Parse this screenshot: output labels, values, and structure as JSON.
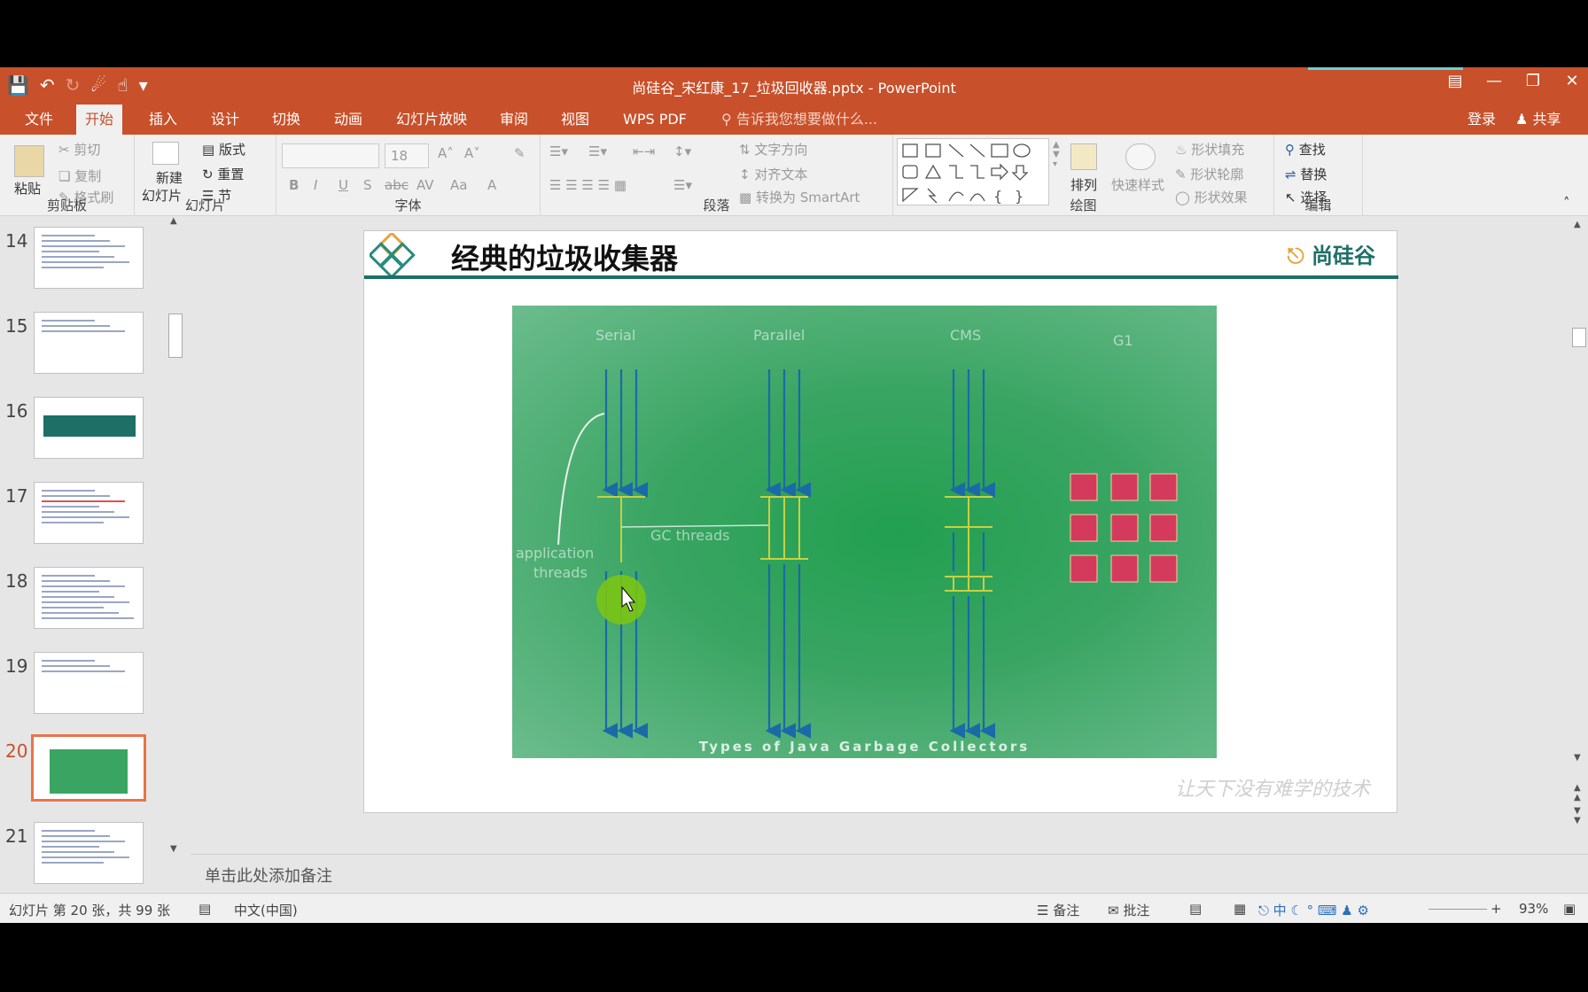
{
  "window": {
    "title": "尚硅谷_宋红康_17_垃圾回收器.pptx - PowerPoint",
    "controls": [
      "restore-ribbon-icon",
      "minimize-icon",
      "maximize-icon",
      "close-icon"
    ]
  },
  "tabs": {
    "file": "文件",
    "home": "开始",
    "insert": "插入",
    "design": "设计",
    "transitions": "切换",
    "animations": "动画",
    "slideshow": "幻灯片放映",
    "review": "审阅",
    "view": "视图",
    "wps_pdf": "WPS PDF",
    "tell_me": "告诉我您想要做什么...",
    "login": "登录",
    "share": "共享"
  },
  "ribbon": {
    "clipboard": {
      "label": "剪贴板",
      "paste": "粘贴",
      "cut": "剪切",
      "copy": "复制",
      "format_painter": "格式刷"
    },
    "slides": {
      "label": "幻灯片",
      "new_slide_1": "新建",
      "new_slide_2": "幻灯片",
      "layout": "版式",
      "reset": "重置",
      "section": "节"
    },
    "font": {
      "label": "字体",
      "font_size": "18",
      "bold": "B",
      "italic": "I",
      "underline": "U",
      "shadow": "S",
      "strike": "abc",
      "spacing": "AV",
      "case": "Aa",
      "color": "A"
    },
    "paragraph": {
      "label": "段落",
      "text_direction": "文字方向",
      "align_text": "对齐文本",
      "smartart": "转换为 SmartArt"
    },
    "drawing": {
      "label": "绘图",
      "arrange": "排列",
      "quick_styles": "快速样式",
      "shape_fill": "形状填充",
      "shape_outline": "形状轮廓",
      "shape_effects": "形状效果"
    },
    "editing": {
      "label": "编辑",
      "find": "查找",
      "replace": "替换",
      "select": "选择"
    }
  },
  "thumbnails": [
    {
      "num": "14",
      "type": "text"
    },
    {
      "num": "15",
      "type": "text-short"
    },
    {
      "num": "16",
      "type": "banner"
    },
    {
      "num": "17",
      "type": "text-red"
    },
    {
      "num": "18",
      "type": "text-dense"
    },
    {
      "num": "19",
      "type": "text-short"
    },
    {
      "num": "20",
      "type": "figure",
      "selected": true
    },
    {
      "num": "21",
      "type": "text"
    }
  ],
  "slide": {
    "title": "经典的垃圾收集器",
    "brand": "尚硅谷",
    "watermark": "让天下没有难学的技术",
    "figure": {
      "columns": [
        "Serial",
        "Parallel",
        "CMS",
        "G1"
      ],
      "annotation_app": "application",
      "annotation_app2": "threads",
      "annotation_gc": "GC threads",
      "caption": "Types of Java Garbage Collectors"
    }
  },
  "notes_placeholder": "单击此处添加备注",
  "status": {
    "slide_info": "幻灯片 第 20 张，共 99 张",
    "language": "中文(中国)",
    "notes": "备注",
    "comments": "批注",
    "zoom": "93%"
  },
  "colors": {
    "accent": "#c8502a",
    "slide_teal": "#1e6f66",
    "g1_block": "#d43a5c"
  }
}
